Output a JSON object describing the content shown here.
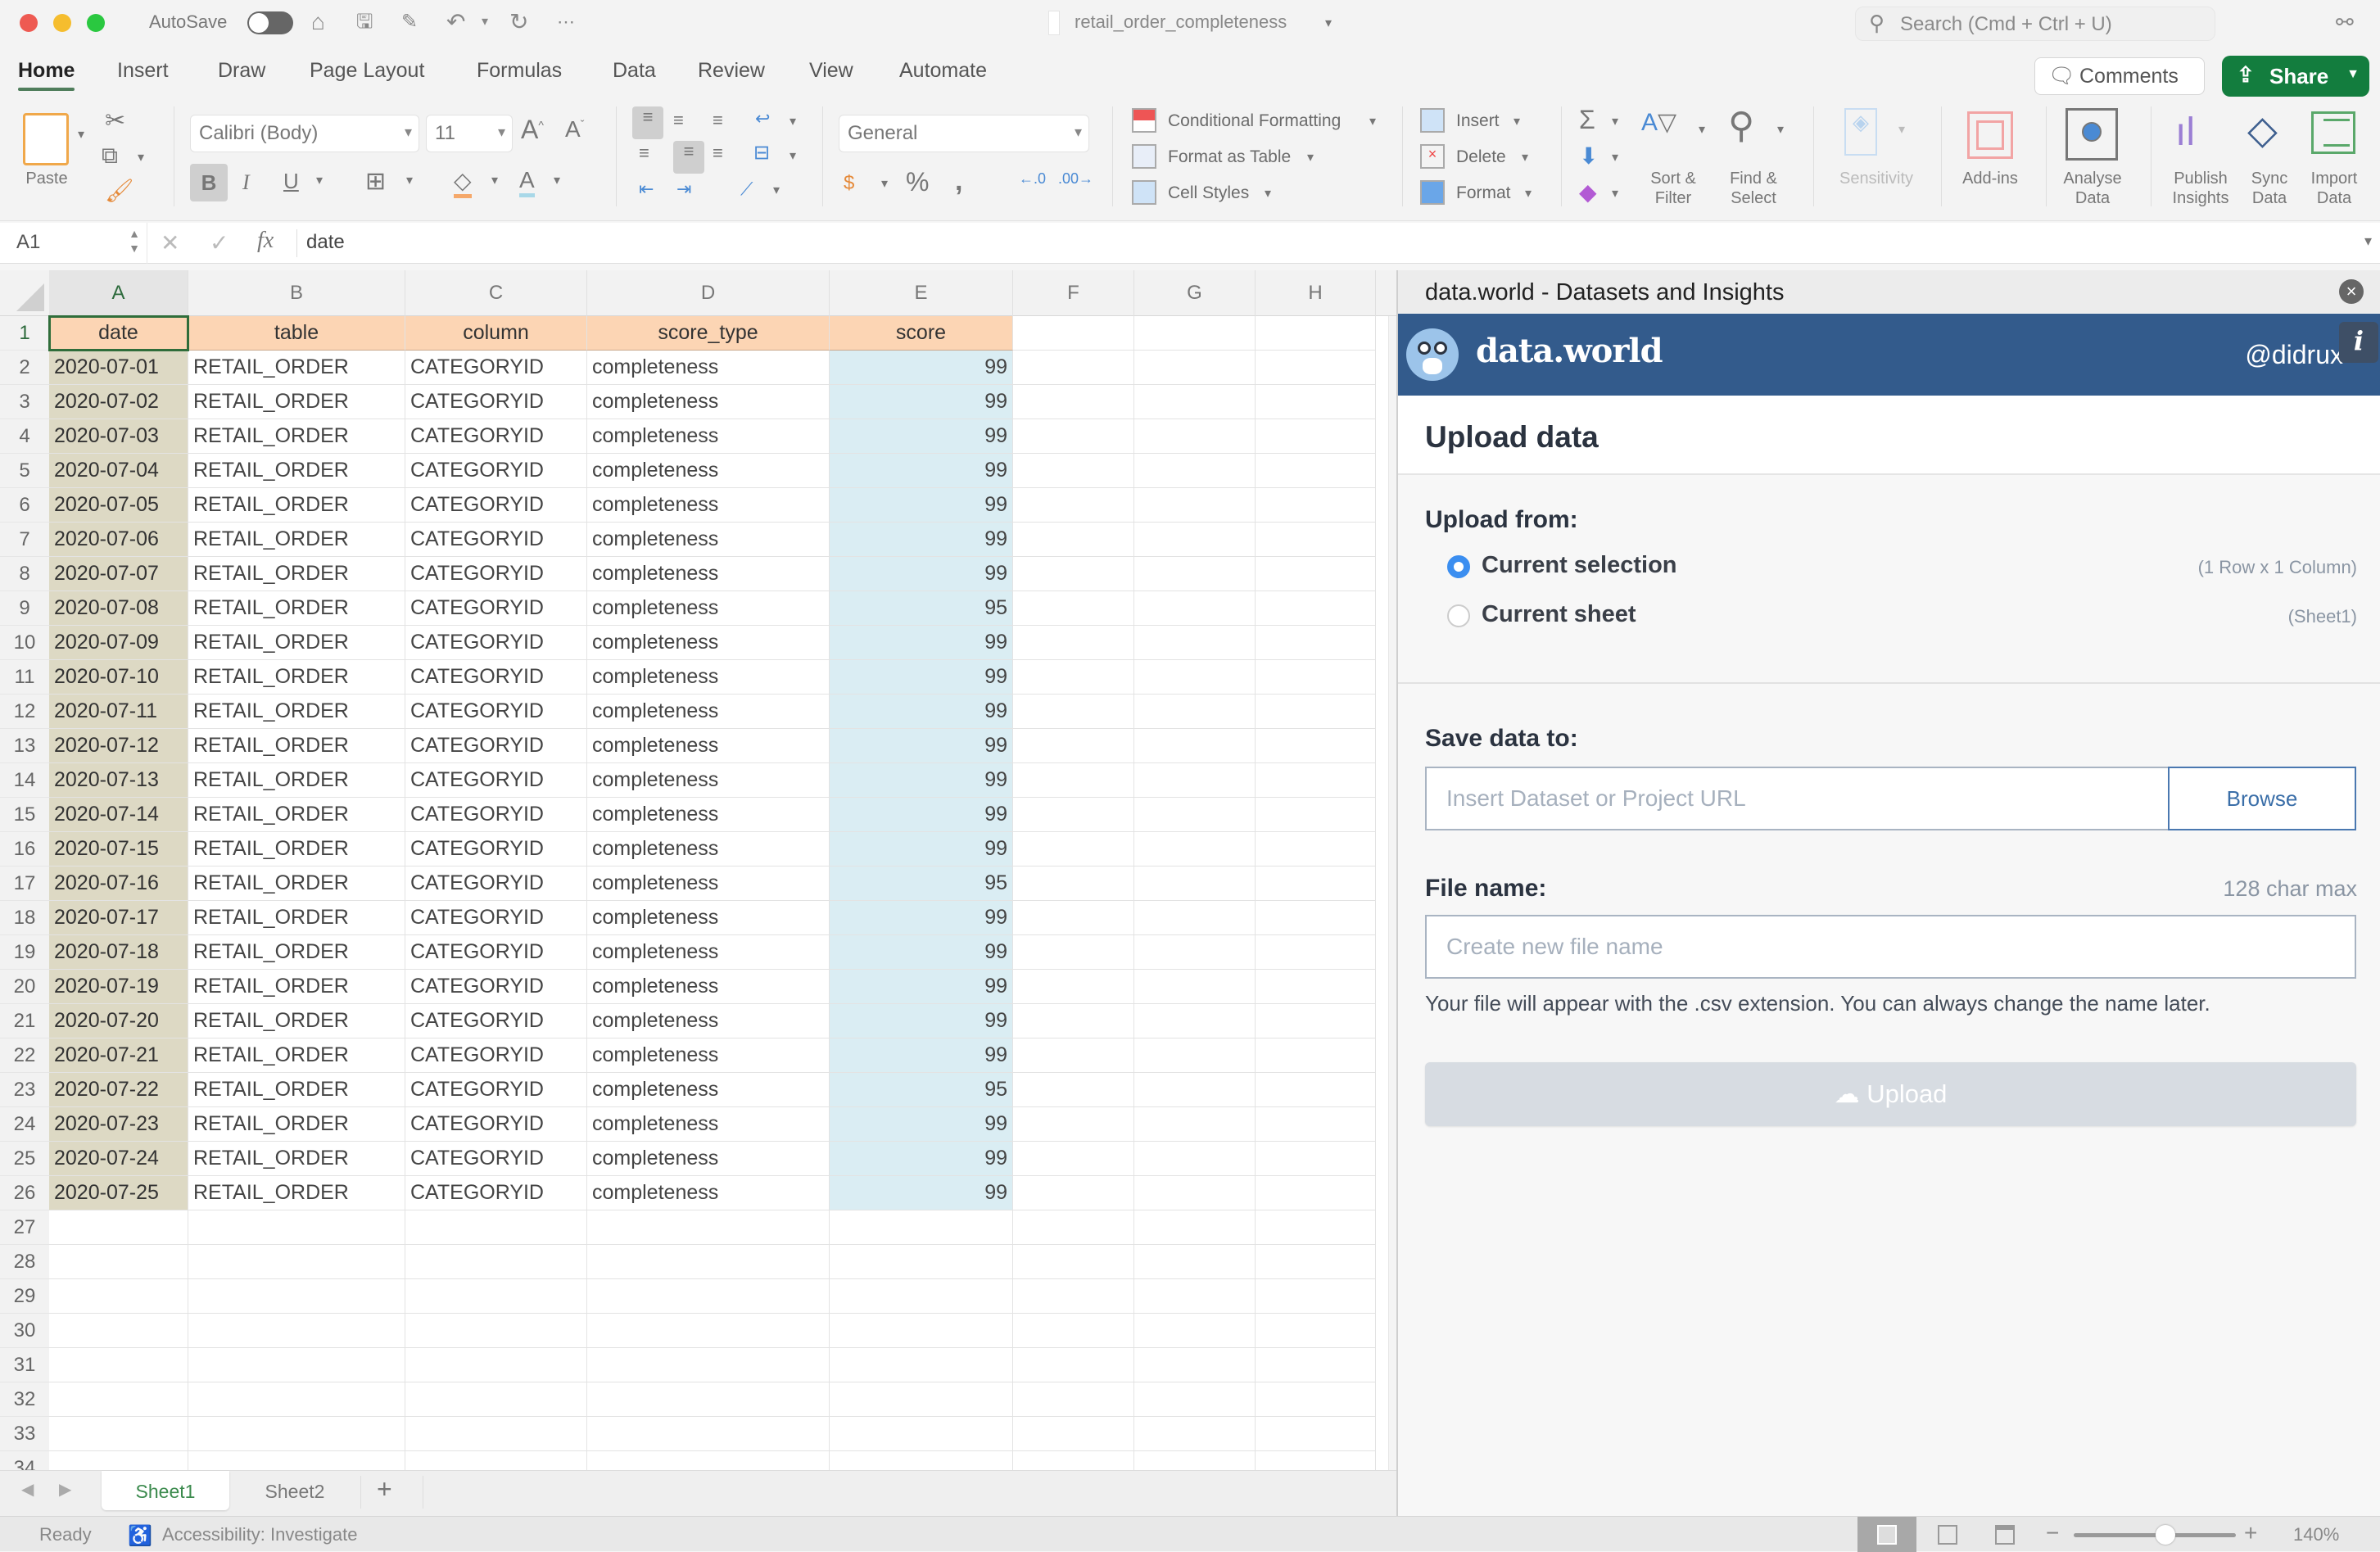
{
  "window": {
    "autosave_label": "AutoSave",
    "autosave_on": false,
    "file_title": "retail_order_completeness",
    "search_placeholder": "Search (Cmd + Ctrl + U)"
  },
  "tabs": [
    {
      "label": "Home",
      "active": true
    },
    {
      "label": "Insert"
    },
    {
      "label": "Draw"
    },
    {
      "label": "Page Layout"
    },
    {
      "label": "Formulas"
    },
    {
      "label": "Data"
    },
    {
      "label": "Review"
    },
    {
      "label": "View"
    },
    {
      "label": "Automate"
    }
  ],
  "header_buttons": {
    "comments": "Comments",
    "share": "Share"
  },
  "ribbon": {
    "paste": "Paste",
    "font_name": "Calibri (Body)",
    "font_size": "11",
    "number_format": "General",
    "conditional_formatting": "Conditional Formatting",
    "format_as_table": "Format as Table",
    "cell_styles": "Cell Styles",
    "insert": "Insert",
    "delete": "Delete",
    "format": "Format",
    "sort_filter": [
      "Sort &",
      "Filter"
    ],
    "find_select": [
      "Find &",
      "Select"
    ],
    "sensitivity": "Sensitivity",
    "add_ins": "Add-ins",
    "analyse_data": [
      "Analyse",
      "Data"
    ],
    "publish_insights": [
      "Publish",
      "Insights"
    ],
    "sync_data": [
      "Sync",
      "Data"
    ],
    "import_data": [
      "Import",
      "Data"
    ]
  },
  "formula_bar": {
    "name_box": "A1",
    "fx": "fx",
    "formula": "date"
  },
  "grid": {
    "columns": [
      "A",
      "B",
      "C",
      "D",
      "E",
      "F",
      "G",
      "H"
    ],
    "selected_column": "A",
    "headers": [
      "date",
      "table",
      "column",
      "score_type",
      "score"
    ],
    "rows": [
      [
        "2020-07-01",
        "RETAIL_ORDER",
        "CATEGORYID",
        "completeness",
        "99"
      ],
      [
        "2020-07-02",
        "RETAIL_ORDER",
        "CATEGORYID",
        "completeness",
        "99"
      ],
      [
        "2020-07-03",
        "RETAIL_ORDER",
        "CATEGORYID",
        "completeness",
        "99"
      ],
      [
        "2020-07-04",
        "RETAIL_ORDER",
        "CATEGORYID",
        "completeness",
        "99"
      ],
      [
        "2020-07-05",
        "RETAIL_ORDER",
        "CATEGORYID",
        "completeness",
        "99"
      ],
      [
        "2020-07-06",
        "RETAIL_ORDER",
        "CATEGORYID",
        "completeness",
        "99"
      ],
      [
        "2020-07-07",
        "RETAIL_ORDER",
        "CATEGORYID",
        "completeness",
        "99"
      ],
      [
        "2020-07-08",
        "RETAIL_ORDER",
        "CATEGORYID",
        "completeness",
        "95"
      ],
      [
        "2020-07-09",
        "RETAIL_ORDER",
        "CATEGORYID",
        "completeness",
        "99"
      ],
      [
        "2020-07-10",
        "RETAIL_ORDER",
        "CATEGORYID",
        "completeness",
        "99"
      ],
      [
        "2020-07-11",
        "RETAIL_ORDER",
        "CATEGORYID",
        "completeness",
        "99"
      ],
      [
        "2020-07-12",
        "RETAIL_ORDER",
        "CATEGORYID",
        "completeness",
        "99"
      ],
      [
        "2020-07-13",
        "RETAIL_ORDER",
        "CATEGORYID",
        "completeness",
        "99"
      ],
      [
        "2020-07-14",
        "RETAIL_ORDER",
        "CATEGORYID",
        "completeness",
        "99"
      ],
      [
        "2020-07-15",
        "RETAIL_ORDER",
        "CATEGORYID",
        "completeness",
        "99"
      ],
      [
        "2020-07-16",
        "RETAIL_ORDER",
        "CATEGORYID",
        "completeness",
        "95"
      ],
      [
        "2020-07-17",
        "RETAIL_ORDER",
        "CATEGORYID",
        "completeness",
        "99"
      ],
      [
        "2020-07-18",
        "RETAIL_ORDER",
        "CATEGORYID",
        "completeness",
        "99"
      ],
      [
        "2020-07-19",
        "RETAIL_ORDER",
        "CATEGORYID",
        "completeness",
        "99"
      ],
      [
        "2020-07-20",
        "RETAIL_ORDER",
        "CATEGORYID",
        "completeness",
        "99"
      ],
      [
        "2020-07-21",
        "RETAIL_ORDER",
        "CATEGORYID",
        "completeness",
        "99"
      ],
      [
        "2020-07-22",
        "RETAIL_ORDER",
        "CATEGORYID",
        "completeness",
        "95"
      ],
      [
        "2020-07-23",
        "RETAIL_ORDER",
        "CATEGORYID",
        "completeness",
        "99"
      ],
      [
        "2020-07-24",
        "RETAIL_ORDER",
        "CATEGORYID",
        "completeness",
        "99"
      ],
      [
        "2020-07-25",
        "RETAIL_ORDER",
        "CATEGORYID",
        "completeness",
        "99"
      ]
    ],
    "visible_row_count": 34
  },
  "sheets": [
    {
      "label": "Sheet1",
      "active": true
    },
    {
      "label": "Sheet2"
    }
  ],
  "status": {
    "ready": "Ready",
    "accessibility": "Accessibility: Investigate",
    "zoom": "140%",
    "zoom_level_pct": 140
  },
  "panel": {
    "title": "data.world - Datasets and Insights",
    "brand": "data.world",
    "user": "@didrux",
    "heading": "Upload data",
    "upload_from_label": "Upload from:",
    "options": [
      {
        "label": "Current selection",
        "meta": "(1 Row x 1 Column)",
        "checked": true
      },
      {
        "label": "Current sheet",
        "meta": "(Sheet1)",
        "checked": false
      }
    ],
    "save_to_label": "Save data to:",
    "url_placeholder": "Insert Dataset or Project URL",
    "url_value": "",
    "browse": "Browse",
    "file_name_label": "File name:",
    "char_max": "128 char max",
    "file_name_placeholder": "Create new file name",
    "file_name_value": "",
    "hint": "Your file will appear with the .csv extension. You can always change the name later.",
    "upload": "Upload"
  },
  "colors": {
    "excel_green": "#137d3e",
    "dw_blue": "#335b8c",
    "header_fill": "#fcd5b4",
    "date_fill": "#ddd9c4",
    "score_fill": "#daedf3",
    "radio_blue": "#3b8ef0"
  }
}
